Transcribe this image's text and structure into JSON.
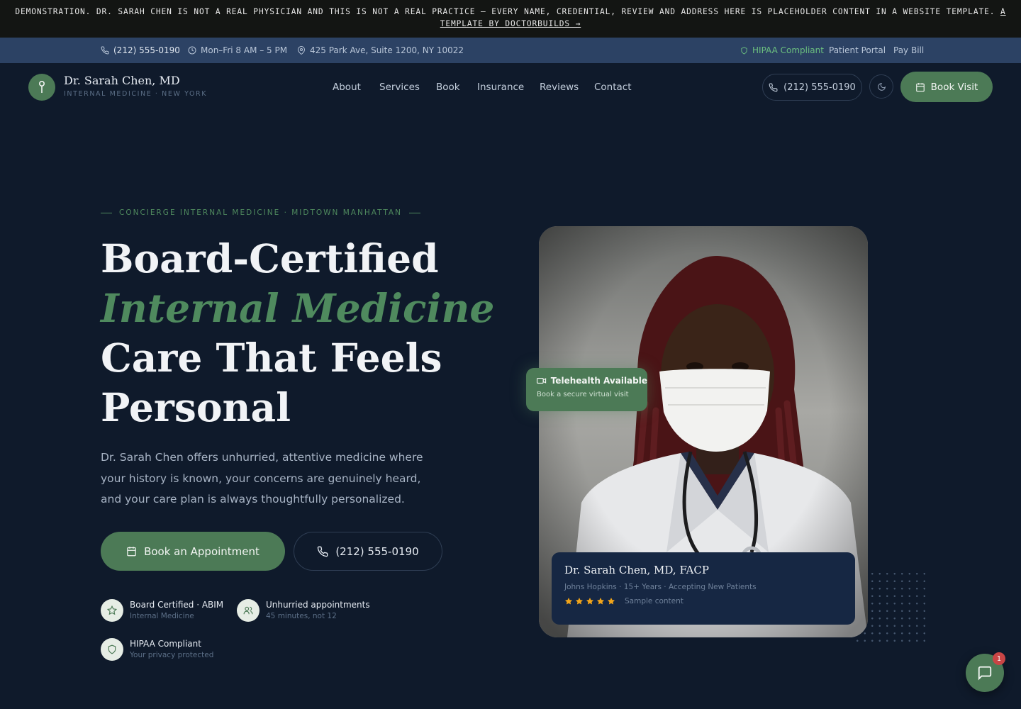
{
  "banner": {
    "text": "DEMONSTRATION. DR. SARAH CHEN IS NOT A REAL PHYSICIAN AND THIS IS NOT A REAL PRACTICE — EVERY NAME, CREDENTIAL, REVIEW AND ADDRESS HERE IS PLACEHOLDER CONTENT IN A WEBSITE TEMPLATE.",
    "link": "A TEMPLATE BY DOCTORBUILDS →"
  },
  "utility": {
    "phone": "(212) 555-0190",
    "hours": "Mon–Fri 8 AM – 5 PM",
    "address": "425 Park Ave, Suite 1200, NY 10022",
    "hipaa": "HIPAA Compliant",
    "portal": "Patient Portal",
    "pay": "Pay Bill"
  },
  "nav": {
    "brand_name": "Dr. Sarah Chen, MD",
    "brand_sub": "INTERNAL MEDICINE · NEW YORK",
    "items": [
      "About",
      "Services",
      "Book",
      "Insurance",
      "Reviews",
      "Contact"
    ],
    "phone": "(212) 555-0190",
    "book": "Book Visit"
  },
  "hero": {
    "eyebrow": "CONCIERGE INTERNAL MEDICINE · MIDTOWN MANHATTAN",
    "line1": "Board-Certified",
    "line2": "Internal Medicine",
    "line3": "Care That Feels",
    "line4": "Personal",
    "lead": "Dr. Sarah Chen offers unhurried, attentive medicine where your history is known, your concerns are genuinely heard, and your care plan is always thoughtfully personalized.",
    "cta_primary": "Book an Appointment",
    "cta_phone": "(212) 555-0190",
    "badges": [
      {
        "title": "Board Certified · ABIM",
        "sub": "Internal Medicine",
        "icon": "star-icon"
      },
      {
        "title": "Unhurried appointments",
        "sub": "45 minutes, not 12",
        "icon": "users-icon"
      },
      {
        "title": "HIPAA Compliant",
        "sub": "Your privacy protected",
        "icon": "shield-icon"
      }
    ]
  },
  "telehealth": {
    "title": "Telehealth Available",
    "sub": "Book a secure virtual visit"
  },
  "doctor_card": {
    "name": "Dr. Sarah Chen, MD, FACP",
    "meta": "Johns Hopkins · 15+ Years · Accepting New Patients",
    "rating": 5,
    "rating_note": "Sample content"
  },
  "chat": {
    "count": "1"
  },
  "colors": {
    "accent": "#4c7a56",
    "background": "#0f1a2b",
    "utility_bar": "#2c4264",
    "star": "#f2a51a"
  }
}
